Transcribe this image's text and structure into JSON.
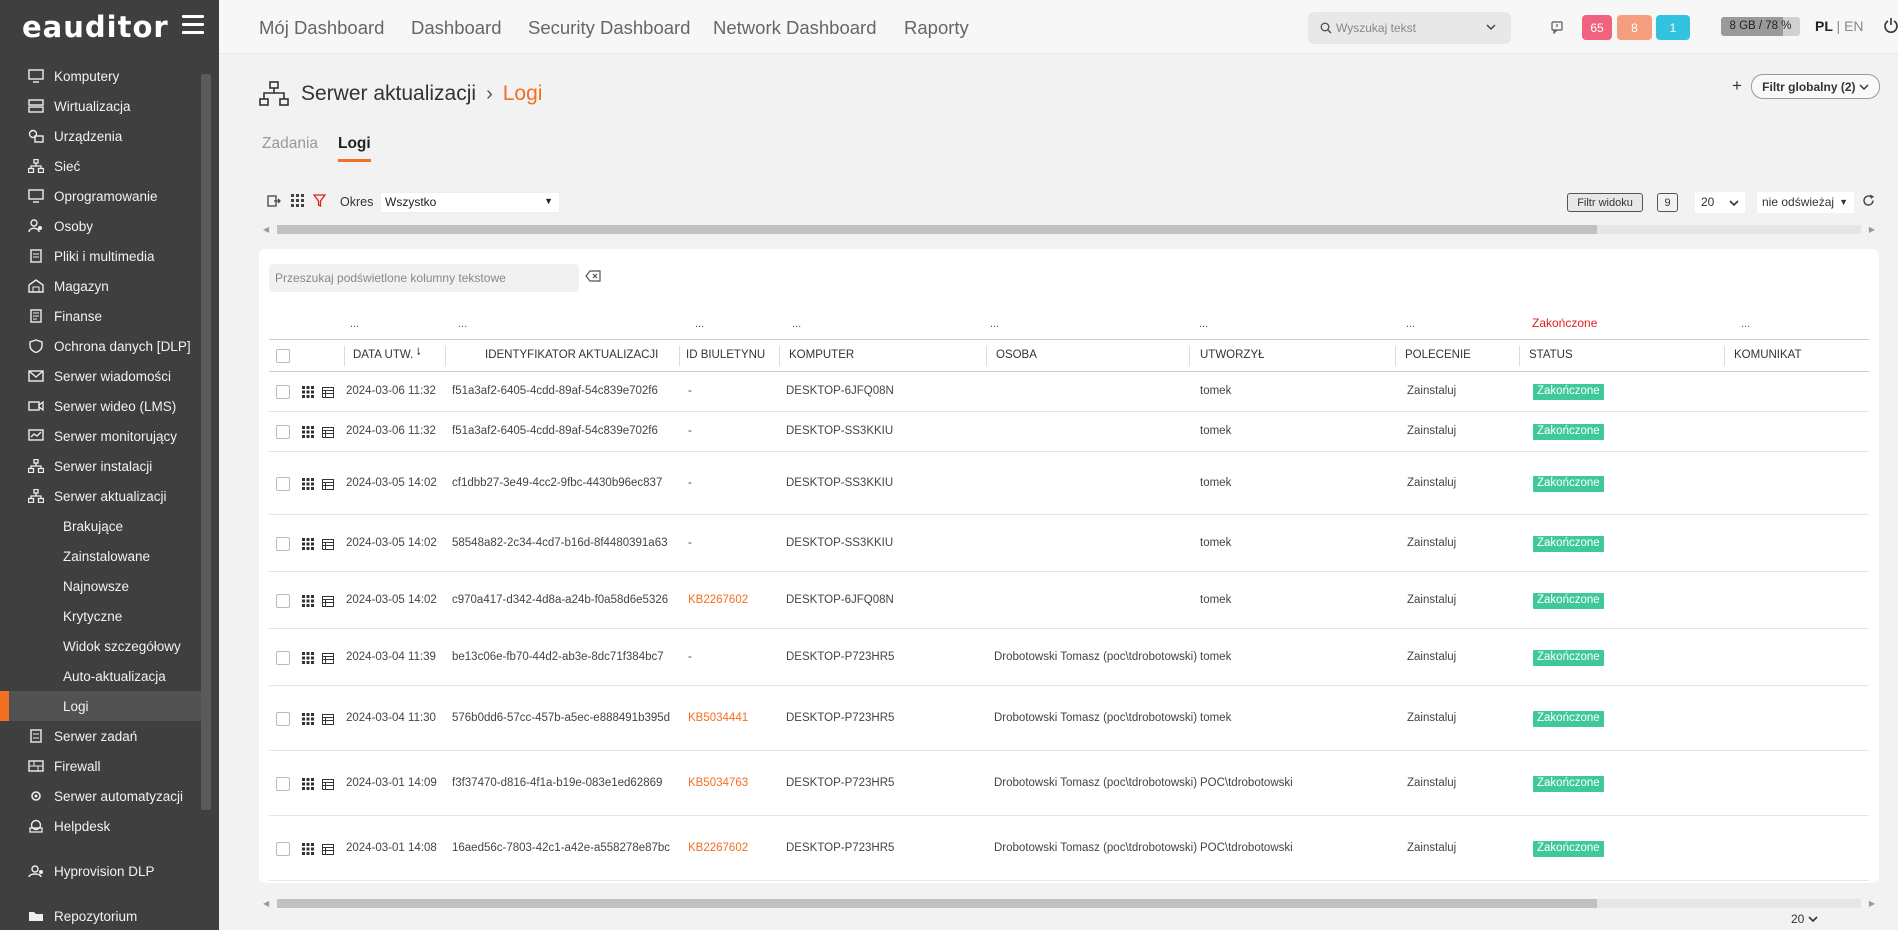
{
  "brand": {
    "logo": "eauditor"
  },
  "sidebar": {
    "items": [
      {
        "label": "Komputery",
        "icon": "monitor-icon"
      },
      {
        "label": "Wirtualizacja",
        "icon": "servers-icon"
      },
      {
        "label": "Urządzenia",
        "icon": "devices-icon"
      },
      {
        "label": "Sieć",
        "icon": "network-icon"
      },
      {
        "label": "Oprogramowanie",
        "icon": "monitor-icon"
      },
      {
        "label": "Osoby",
        "icon": "users-icon"
      },
      {
        "label": "Pliki i multimedia",
        "icon": "file-icon"
      },
      {
        "label": "Magazyn",
        "icon": "warehouse-icon"
      },
      {
        "label": "Finanse",
        "icon": "finance-icon"
      },
      {
        "label": "Ochrona danych [DLP]",
        "icon": "shield-icon"
      },
      {
        "label": "Serwer wiadomości",
        "icon": "mail-icon"
      },
      {
        "label": "Serwer wideo (LMS)",
        "icon": "video-icon"
      },
      {
        "label": "Serwer monitorujący",
        "icon": "monitor-chart-icon"
      },
      {
        "label": "Serwer instalacji",
        "icon": "network-icon"
      },
      {
        "label": "Serwer aktualizacji",
        "icon": "network-icon"
      }
    ],
    "subitems": [
      "Brakujące",
      "Zainstalowane",
      "Najnowsze",
      "Krytyczne",
      "Widok szczegółowy",
      "Auto-aktualizacja",
      "Logi"
    ],
    "items_after": [
      {
        "label": "Serwer zadań",
        "icon": "tasks-icon"
      },
      {
        "label": "Firewall",
        "icon": "firewall-icon"
      },
      {
        "label": "Serwer automatyzacji",
        "icon": "automation-icon"
      },
      {
        "label": "Helpdesk",
        "icon": "helpdesk-icon"
      }
    ],
    "bottom": [
      {
        "label": "Hyprovision DLP",
        "icon": "hyprovision-icon"
      },
      {
        "label": "Repozytorium",
        "icon": "folder-icon"
      }
    ]
  },
  "topnav": [
    "Mój Dashboard",
    "Dashboard",
    "Security Dashboard",
    "Network Dashboard",
    "Raporty"
  ],
  "search": {
    "placeholder": "Wyszukaj tekst"
  },
  "badges": [
    {
      "value": "65",
      "color": "#f0627e"
    },
    {
      "value": "8",
      "color": "#f59e7e"
    },
    {
      "value": "1",
      "color": "#33c3e0"
    }
  ],
  "memory": {
    "label": "8 GB / 78 %",
    "percent": 78
  },
  "lang": {
    "pl": "PL",
    "sep": "|",
    "en": "EN"
  },
  "breadcrumb": {
    "parent": "Serwer aktualizacji",
    "current": "Logi"
  },
  "global_filter": "Filtr globalny (2)",
  "tabs": [
    {
      "label": "Zadania"
    },
    {
      "label": "Logi"
    }
  ],
  "toolbar": {
    "okres_label": "Okres",
    "okres_value": "Wszystko",
    "view_filter": "Filtr widoku",
    "count": "9",
    "per_page": "20",
    "refresh": "nie odświeżaj"
  },
  "table": {
    "filter_placeholder": "Przeszukaj podświetlone kolumny tekstowe",
    "filter_row": [
      "...",
      "...",
      "...",
      "...",
      "...",
      "...",
      "...",
      "Zakończone",
      "..."
    ],
    "columns": [
      "DATA UTW.",
      "IDENTYFIKATOR AKTUALIZACJI",
      "ID BIULETYNU",
      "KOMPUTER",
      "OSOBA",
      "UTWORZYŁ",
      "POLECENIE",
      "STATUS",
      "KOMUNIKAT"
    ],
    "rows": [
      {
        "date": "2024-03-06 11:32",
        "id": "f51a3af2-6405-4cdd-89af-54c839e702f6",
        "kb": "-",
        "computer": "DESKTOP-6JFQ08N",
        "person": "",
        "created_by": "tomek",
        "command": "Zainstaluj",
        "status": "Zakończone"
      },
      {
        "date": "2024-03-06 11:32",
        "id": "f51a3af2-6405-4cdd-89af-54c839e702f6",
        "kb": "-",
        "computer": "DESKTOP-SS3KKIU",
        "person": "",
        "created_by": "tomek",
        "command": "Zainstaluj",
        "status": "Zakończone"
      },
      {
        "date": "2024-03-05 14:02",
        "id": "cf1dbb27-3e49-4cc2-9fbc-4430b96ec837",
        "kb": "-",
        "computer": "DESKTOP-SS3KKIU",
        "person": "",
        "created_by": "tomek",
        "command": "Zainstaluj",
        "status": "Zakończone"
      },
      {
        "date": "2024-03-05 14:02",
        "id": "58548a82-2c34-4cd7-b16d-8f4480391a63",
        "kb": "-",
        "computer": "DESKTOP-SS3KKIU",
        "person": "",
        "created_by": "tomek",
        "command": "Zainstaluj",
        "status": "Zakończone"
      },
      {
        "date": "2024-03-05 14:02",
        "id": "c970a417-d342-4d8a-a24b-f0a58d6e5326",
        "kb": "KB2267602",
        "computer": "DESKTOP-6JFQ08N",
        "person": "",
        "created_by": "tomek",
        "command": "Zainstaluj",
        "status": "Zakończone"
      },
      {
        "date": "2024-03-04 11:39",
        "id": "be13c06e-fb70-44d2-ab3e-8dc71f384bc7",
        "kb": "-",
        "computer": "DESKTOP-P723HR5",
        "person": "Drobotowski Tomasz (poc\\tdrobotowski)",
        "created_by": "tomek",
        "command": "Zainstaluj",
        "status": "Zakończone"
      },
      {
        "date": "2024-03-04 11:30",
        "id": "576b0dd6-57cc-457b-a5ec-e888491b395d",
        "kb": "KB5034441",
        "computer": "DESKTOP-P723HR5",
        "person": "Drobotowski Tomasz (poc\\tdrobotowski)",
        "created_by": "tomek",
        "command": "Zainstaluj",
        "status": "Zakończone"
      },
      {
        "date": "2024-03-01 14:09",
        "id": "f3f37470-d816-4f1a-b19e-083e1ed62869",
        "kb": "KB5034763",
        "computer": "DESKTOP-P723HR5",
        "person": "Drobotowski Tomasz (poc\\tdrobotowski)",
        "created_by": "POC\\tdrobotowski",
        "command": "Zainstaluj",
        "status": "Zakończone"
      },
      {
        "date": "2024-03-01 14:08",
        "id": "16aed56c-7803-42c1-a42e-a558278e87bc",
        "kb": "KB2267602",
        "computer": "DESKTOP-P723HR5",
        "person": "Drobotowski Tomasz (poc\\tdrobotowski)",
        "created_by": "POC\\tdrobotowski",
        "command": "Zainstaluj",
        "status": "Zakończone"
      }
    ]
  },
  "footer": {
    "per_page": "20"
  },
  "colors": {
    "accent": "#f36f21",
    "status_done": "#3fc99a",
    "sidebar_bg": "#3f3f3f"
  }
}
